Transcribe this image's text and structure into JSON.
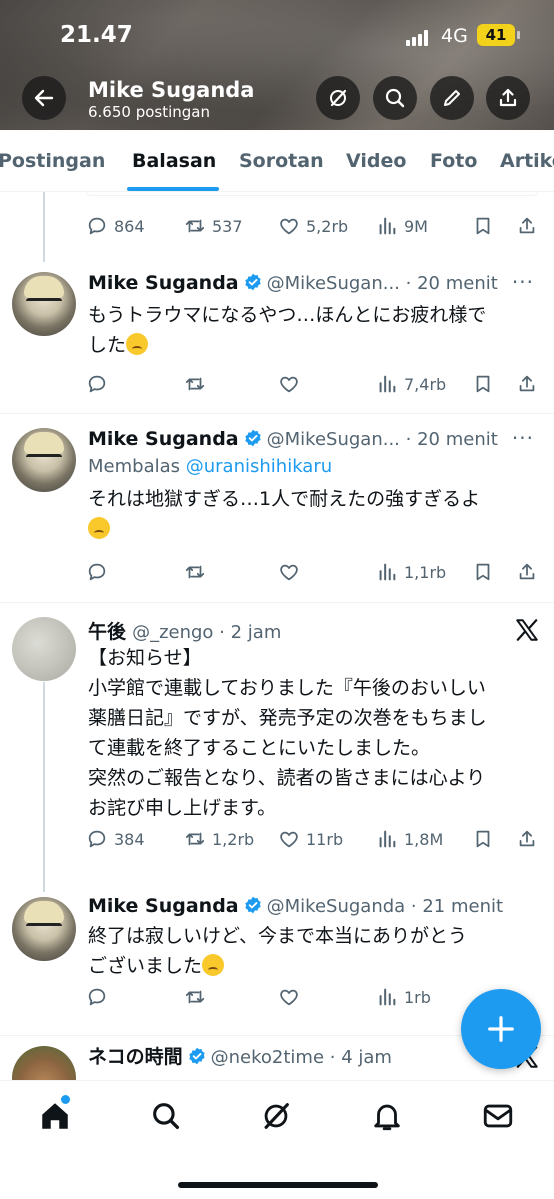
{
  "status_bar": {
    "time": "21.47",
    "network": "4G",
    "battery": "41"
  },
  "header": {
    "name": "Mike Suganda",
    "posts_count": "6.650 postingan"
  },
  "tabs": [
    {
      "label": "Postingan",
      "active": false
    },
    {
      "label": "Balasan",
      "active": true
    },
    {
      "label": "Sorotan",
      "active": false
    },
    {
      "label": "Video",
      "active": false
    },
    {
      "label": "Foto",
      "active": false
    },
    {
      "label": "Artikel",
      "active": false
    }
  ],
  "posts": [
    {
      "replies": "864",
      "reposts": "537",
      "likes": "5,2rb",
      "views": "9M"
    },
    {
      "name": "Mike Suganda",
      "verified": true,
      "handle": "@MikeSugan...",
      "time": "20 menit",
      "text": "もうトラウマになるやつ…ほんとにお疲れ様でした",
      "text_line1": "もうトラウマになるやつ…ほんとにお疲れ様で",
      "text_line2": "した",
      "replies": "",
      "reposts": "",
      "likes": "",
      "views": "7,4rb"
    },
    {
      "name": "Mike Suganda",
      "verified": true,
      "handle": "@MikeSugan...",
      "time": "20 menit",
      "reply_prefix": "Membalas",
      "reply_to": "@uranishihikaru",
      "text_line1": "それは地獄すぎる…1人で耐えたの強すぎるよ",
      "replies": "",
      "reposts": "",
      "likes": "",
      "views": "1,1rb"
    },
    {
      "name": "午後",
      "verified": false,
      "handle": "@_zengo",
      "time": "2 jam",
      "text_lines": [
        "【お知らせ】",
        "小学館で連載しておりました『午後のおいしい",
        "薬膳日記』ですが、発売予定の次巻をもちまし",
        "て連載を終了することにいたしました。",
        "突然のご報告となり、読者の皆さまには心より",
        "お詫び申し上げます。"
      ],
      "replies": "384",
      "reposts": "1,2rb",
      "likes": "11rb",
      "views": "1,8M"
    },
    {
      "name": "Mike Suganda",
      "verified": true,
      "handle": "@MikeSuganda",
      "time": "21 menit",
      "text_line1": "終了は寂しいけど、今まで本当にありがとう",
      "text_line2": "ございました",
      "replies": "",
      "reposts": "",
      "likes": "",
      "views": "1rb"
    },
    {
      "name": "ネコの時間",
      "verified": true,
      "handle": "@neko2time",
      "time": "4 jam"
    }
  ],
  "icons": {
    "back": "arrow-left-icon",
    "grok": "grok-icon",
    "search": "search-icon",
    "edit": "pencil-icon",
    "share": "share-icon",
    "reply": "reply-icon",
    "repost": "repost-icon",
    "like": "heart-icon",
    "views": "views-icon",
    "bookmark": "bookmark-icon",
    "compose": "plus-icon",
    "home": "home-icon",
    "notifications": "bell-icon",
    "messages": "mail-icon"
  },
  "colors": {
    "accent": "#1d9bf0",
    "text": "#0f1419",
    "muted": "#536471",
    "battery": "#f2d21a"
  }
}
